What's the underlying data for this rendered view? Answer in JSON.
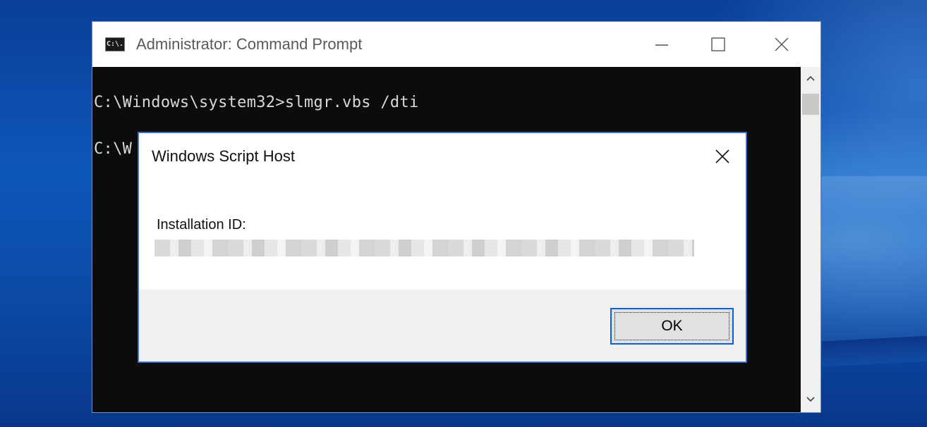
{
  "desktop": {
    "background_color": "#0d56b8"
  },
  "cmd_window": {
    "icon_text": "C:\\.",
    "title": "Administrator: Command Prompt",
    "console_lines": [
      "C:\\Windows\\system32>slmgr.vbs /dti",
      "C:\\W"
    ],
    "console_bg": "#0c0c0c",
    "console_fg": "#d8d8d8"
  },
  "dialog": {
    "title": "Windows Script Host",
    "label": "Installation ID:",
    "installation_id": "",
    "ok_label": "OK",
    "accent": "#0a5fd1"
  },
  "icons": {
    "minimize": "minimize-icon",
    "maximize": "maximize-icon",
    "close": "close-icon",
    "scroll_up": "chevron-up-icon",
    "scroll_down": "chevron-down-icon"
  }
}
